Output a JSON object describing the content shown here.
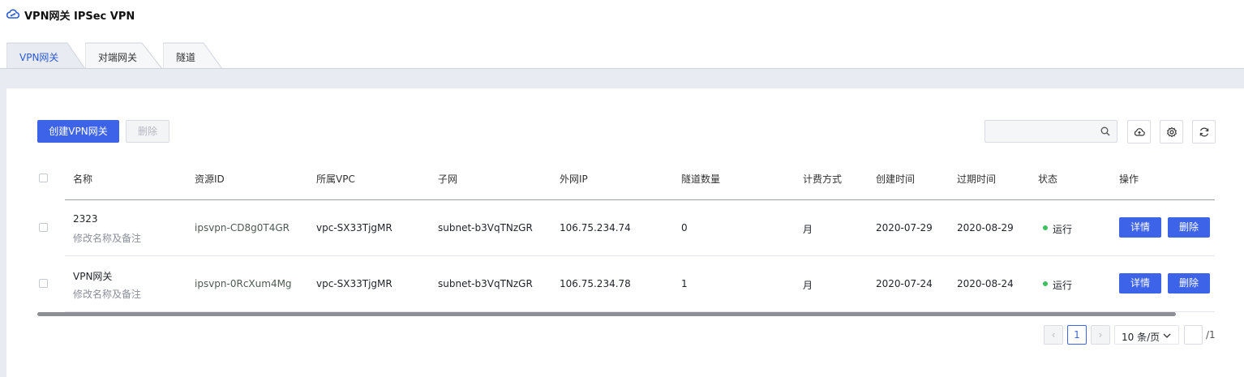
{
  "header": {
    "title": "VPN网关 IPSec VPN",
    "logo_icon": "cloud-link-icon"
  },
  "tabs": [
    {
      "label": "VPN网关",
      "active": true
    },
    {
      "label": "对端网关",
      "active": false
    },
    {
      "label": "隧道",
      "active": false
    }
  ],
  "toolbar": {
    "create_label": "创建VPN网关",
    "delete_label": "删除",
    "search_placeholder": "",
    "icons": [
      "search-icon",
      "cloud-upload-icon",
      "gear-icon",
      "refresh-icon"
    ]
  },
  "table": {
    "columns": [
      "名称",
      "资源ID",
      "所属VPC",
      "子网",
      "外网IP",
      "隧道数量",
      "计费方式",
      "创建时间",
      "过期时间",
      "状态",
      "操作"
    ],
    "rows": [
      {
        "name": "2323",
        "note": "修改名称及备注",
        "resource_id": "ipsvpn-CD8g0T4GR",
        "vpc": "vpc-SX33TjgMR",
        "subnet": "subnet-b3VqTNzGR",
        "public_ip": "106.75.234.74",
        "tunnels": "0",
        "billing": "月",
        "created": "2020-07-29",
        "expires": "2020-08-29",
        "status": "运行",
        "status_color": "#3cc161",
        "detail_label": "详情",
        "delete_label": "删除"
      },
      {
        "name": "VPN网关",
        "note": "修改名称及备注",
        "resource_id": "ipsvpn-0RcXum4Mg",
        "vpc": "vpc-SX33TjgMR",
        "subnet": "subnet-b3VqTNzGR",
        "public_ip": "106.75.234.78",
        "tunnels": "1",
        "billing": "月",
        "created": "2020-07-24",
        "expires": "2020-08-24",
        "status": "运行",
        "status_color": "#3cc161",
        "detail_label": "详情",
        "delete_label": "删除"
      }
    ]
  },
  "pagination": {
    "prev": "‹",
    "current": "1",
    "next": "›",
    "page_size": "10 条/页",
    "page_input": "",
    "total": "/1"
  },
  "colors": {
    "accent": "#3d63e8",
    "status_running": "#3cc161"
  }
}
